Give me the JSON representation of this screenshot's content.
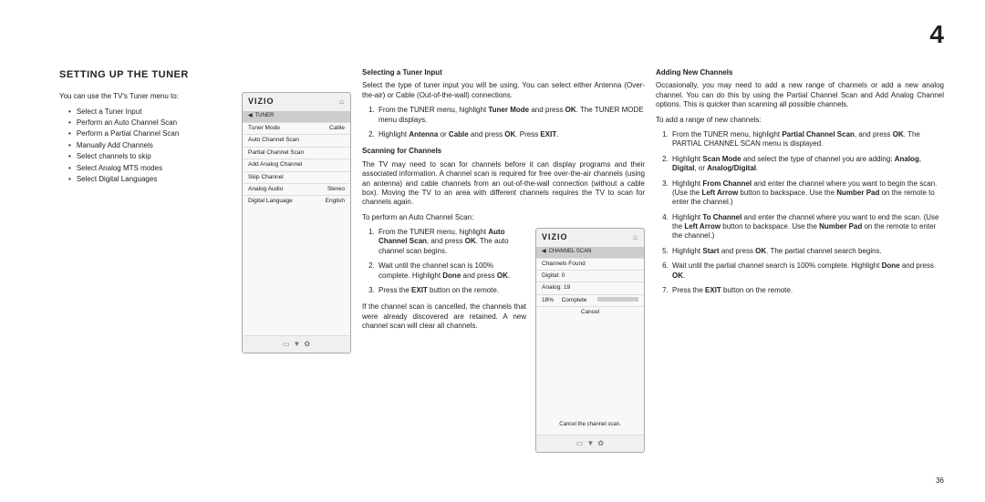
{
  "page_number_large": "4",
  "page_number_small": "36",
  "section_title": "SETTING UP THE TUNER",
  "col1": {
    "intro": "You can use the TV's Tuner menu to:",
    "bullets": [
      "Select a Tuner Input",
      "Perform an Auto Channel Scan",
      "Perform a Partial Channel Scan",
      "Manually Add Channels",
      "Select channels to skip",
      "Select Analog MTS modes",
      "Select Digital Languages"
    ]
  },
  "menu1": {
    "brand": "VIZIO",
    "title": "TUNER",
    "rows": [
      {
        "label": "Tuner Mode",
        "value": "Cable"
      },
      {
        "label": "Auto Channel Scan",
        "value": ""
      },
      {
        "label": "Partial Channel Scan",
        "value": ""
      },
      {
        "label": "Add Analog Channel",
        "value": ""
      },
      {
        "label": "Skip Channel",
        "value": ""
      },
      {
        "label": "Analog Audio",
        "value": "Stereo"
      },
      {
        "label": "Digital Language",
        "value": "English"
      }
    ]
  },
  "col2": {
    "h1": "Selecting a Tuner Input",
    "p1": "Select the type of tuner input you will be using. You can select either Antenna (Over-the-air) or Cable (Out-of-the-wall) connections.",
    "steps1": [
      "From the TUNER menu, highlight <b>Tuner Mode</b> and press <b>OK</b>. The TUNER MODE menu displays.",
      "Highlight <b>Antenna</b> or <b>Cable</b> and press <b>OK</b>. Press <b>EXIT</b>."
    ],
    "h2": "Scanning for Channels",
    "p2": "The TV may need to scan for channels before it can display programs and their associated information. A channel scan is required for free over-the-air channels (using an antenna) and cable channels from an out-of-the-wall connection (without a cable box). Moving the TV to an area with different channels requires the TV to scan for channels again.",
    "p3": "To perform an Auto Channel Scan:",
    "steps2": [
      "From the TUNER menu, highlight <b>Auto Channel Scan</b>, and press <b>OK</b>. The auto channel scan begins.",
      "Wait until the channel scan is 100% complete. Highlight <b>Done</b> and press <b>OK</b>.",
      "Press the <b>EXIT</b> button on the remote."
    ],
    "p4": "If the channel scan is cancelled, the channels that were already discovered are retained. A new channel scan will clear all channels."
  },
  "menu2": {
    "brand": "VIZIO",
    "title": "CHANNEL SCAN",
    "rows": [
      {
        "label": "Channels Found",
        "value": ""
      },
      {
        "label": "Digital: 0",
        "value": ""
      },
      {
        "label": "Analog: 19",
        "value": ""
      }
    ],
    "progress_label": "18%",
    "progress_text": "Complete",
    "cancel_label": "Cancel",
    "note": "Cancel the channel scan."
  },
  "col3": {
    "h1": "Adding New Channels",
    "p1": "Occasionally, you may need to add a new range of channels or add a new analog channel. You can do this by using the Partial Channel Scan and Add Analog Channel options. This is quicker than scanning all possible channels.",
    "p2": "To add a range of new channels:",
    "steps": [
      "From the TUNER menu, highlight <b>Partial Channel Scan</b>, and press <b>OK</b>. The PARTIAL CHANNEL SCAN menu is displayed.",
      "Highlight <b>Scan Mode</b> and select the type of channel you are adding: <b>Analog</b>, <b>Digital</b>, or <b>Analog/Digital</b>.",
      "Highlight <b>From Channel</b> and enter the channel where you want to begin the scan. (Use the <b>Left Arrow</b> button to backspace. Use the <b>Number Pad</b> on the remote to enter the channel.)",
      "Highlight <b>To Channel</b> and enter the channel where you want to end the scan. (Use the <b>Left Arrow</b> button to backspace. Use the <b>Number Pad</b> on the remote to enter the channel.)",
      "Highlight <b>Start</b> and press <b>OK</b>. The partial channel search begins.",
      "Wait until the partial channel search is 100% complete. Highlight <b>Done</b> and press <b>OK</b>.",
      "Press the <b>EXIT</b> button on the remote."
    ]
  }
}
